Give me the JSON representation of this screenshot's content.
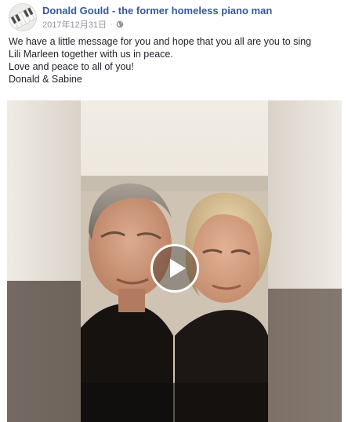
{
  "post": {
    "page_name": "Donald Gould - the former homeless piano man",
    "timestamp": "2017年12月31日",
    "separator": "·",
    "privacy_icon": "globe-icon",
    "message_lines": [
      "We have a little message for you and hope that you all are you to sing",
      "Lili Marleen together with us in peace.",
      "Love and peace to all of you!",
      "Donald & Sabine"
    ]
  },
  "video": {
    "play_icon": "play-icon"
  },
  "colors": {
    "page_name": "#365899",
    "meta_text": "#90949c",
    "body_text": "#1d2129"
  }
}
